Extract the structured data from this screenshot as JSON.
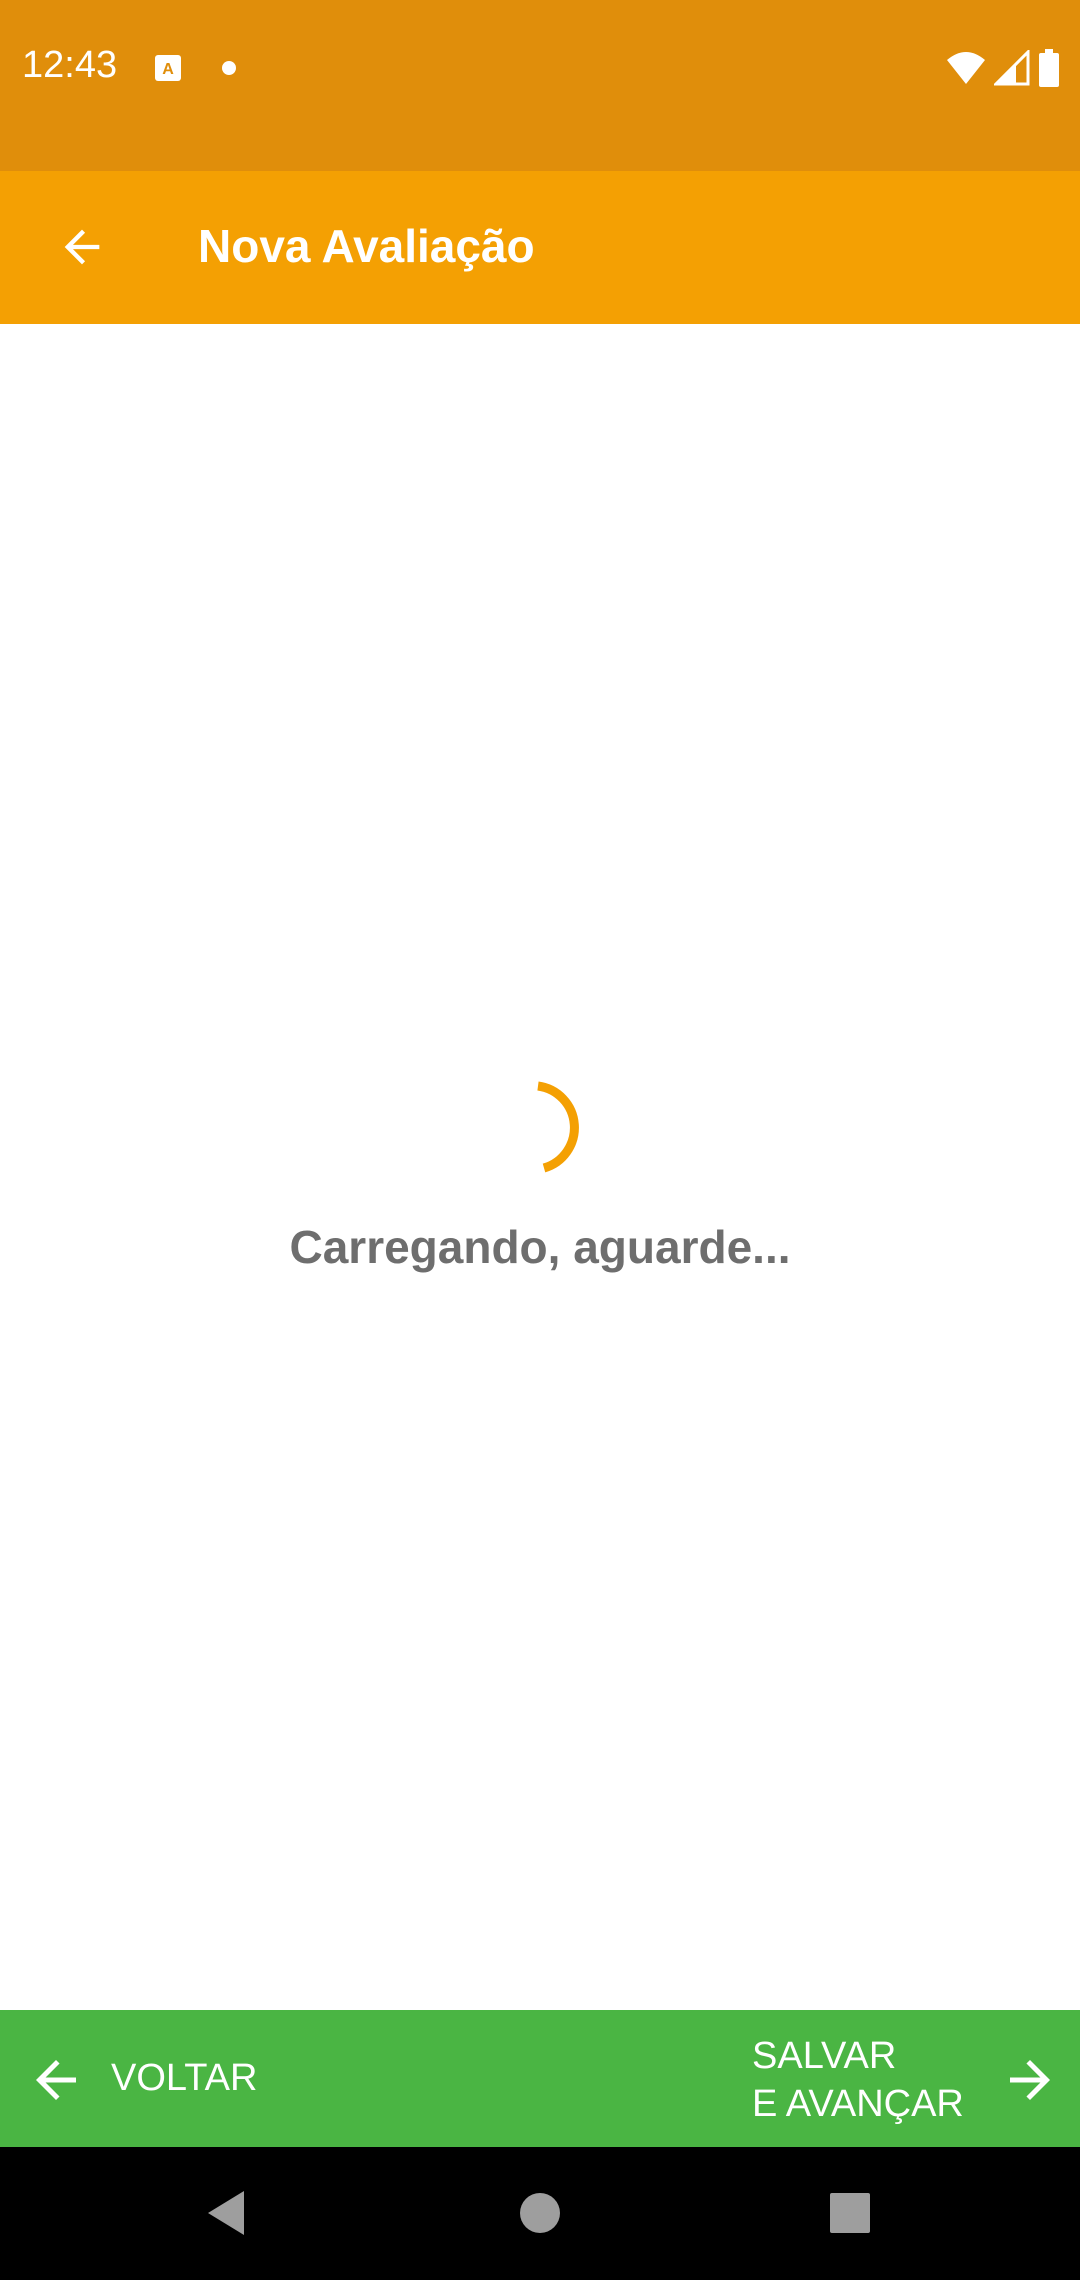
{
  "status_bar": {
    "time": "12:43",
    "icons": [
      "a-notification-icon",
      "dot-icon",
      "wifi-icon",
      "signal-icon",
      "battery-icon"
    ]
  },
  "app_bar": {
    "title": "Nova Avaliação",
    "back_icon": "arrow-back-icon"
  },
  "loader": {
    "text": "Carregando, aguarde..."
  },
  "bottom_bar": {
    "back_label": "VOLTAR",
    "next_label_line1": "SALVAR",
    "next_label_line2": "E AVANÇAR"
  },
  "nav_bar": {
    "buttons": [
      "back-triangle-icon",
      "home-circle-icon",
      "recents-square-icon"
    ]
  },
  "colors": {
    "status_bar": "#E08E0B",
    "app_bar": "#F4A003",
    "spinner": "#F4A003",
    "loading_text": "#6E6E6E",
    "bottom_bar": "#4AB543",
    "nav_bar": "#000000"
  }
}
